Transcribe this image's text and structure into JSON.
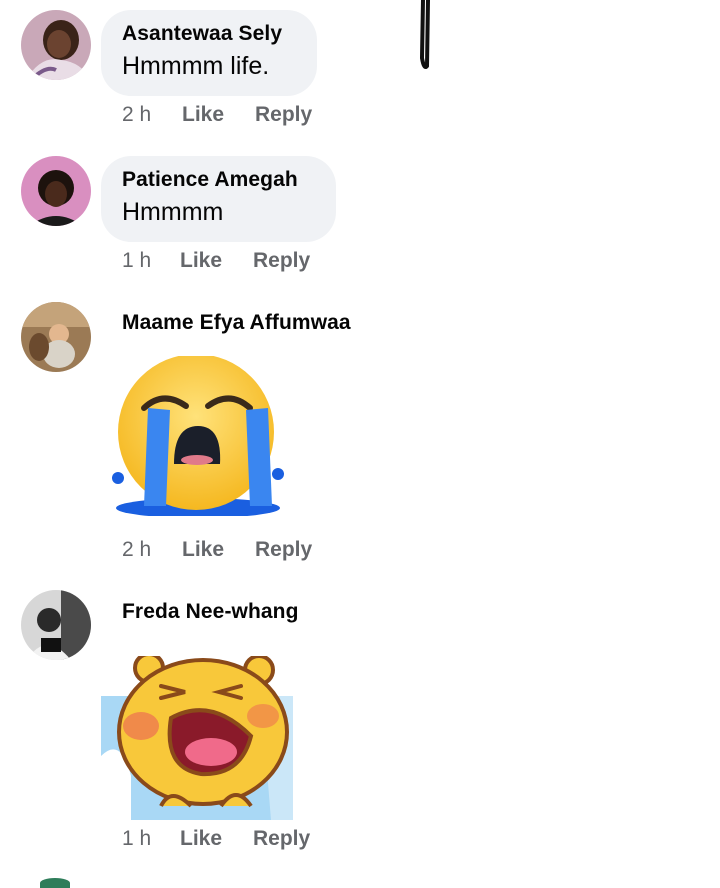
{
  "comments": [
    {
      "name": "Asantewaa Sely",
      "text": "Hmmmm life.",
      "time": "2 h",
      "like": "Like",
      "reply": "Reply"
    },
    {
      "name": "Patience Amegah",
      "text": "Hmmmm",
      "time": "1 h",
      "like": "Like",
      "reply": "Reply"
    },
    {
      "name": "Maame Efya Affumwaa",
      "sticker": "loudly-crying-face-emoji",
      "time": "2 h",
      "like": "Like",
      "reply": "Reply"
    },
    {
      "name": "Freda Nee-whang",
      "sticker": "crying-bear-sticker",
      "time": "1 h",
      "like": "Like",
      "reply": "Reply"
    }
  ],
  "colors": {
    "bubble": "#f0f2f5",
    "meta_text": "#65676b",
    "name_text": "#050505"
  }
}
